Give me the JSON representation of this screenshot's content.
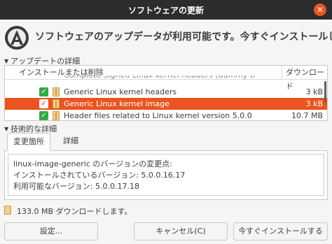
{
  "window": {
    "title": "ソフトウェアの更新",
    "close_glyph": "✕"
  },
  "header": {
    "icon": "software-updater-icon",
    "question": "ソフトウェアのアップデータが利用可能です。今すぐインストールしますか？"
  },
  "updates_section": {
    "label": "アップデートの詳細",
    "columns": {
      "name": "インストールまたは削除",
      "size": "ダウンロード"
    },
    "partial_row": "Complete Signed Linux kernel headers (dummy tr",
    "rows": [
      {
        "checked": true,
        "name": "Generic Linux kernel headers",
        "size": "3 kB",
        "selected": false
      },
      {
        "checked": true,
        "name": "Generic Linux kernel image",
        "size": "3 kB",
        "selected": true
      },
      {
        "checked": true,
        "name": "Header files related to Linux kernel version 5.0.0",
        "size": "10.7 MB",
        "selected": false
      }
    ],
    "check_glyph": "✓"
  },
  "technical_section": {
    "label": "技術的な詳細",
    "tabs": [
      "変更箇所",
      "詳細"
    ],
    "active_tab": 0,
    "changelog": "linux-image-generic のバージョンの変更点:\nインストールされているバージョン: 5.0.0.16.17\n利用可能なバージョン: 5.0.0.17.18"
  },
  "footer": {
    "download_text": "133.0 MB ダウンロードします。",
    "settings_button": "設定...",
    "cancel_button": "キャンセル(C)",
    "install_button": "今すぐインストールする"
  },
  "colors": {
    "titlebar": "#2c2c2c",
    "accent": "#e95420",
    "check": "#37a84a"
  }
}
